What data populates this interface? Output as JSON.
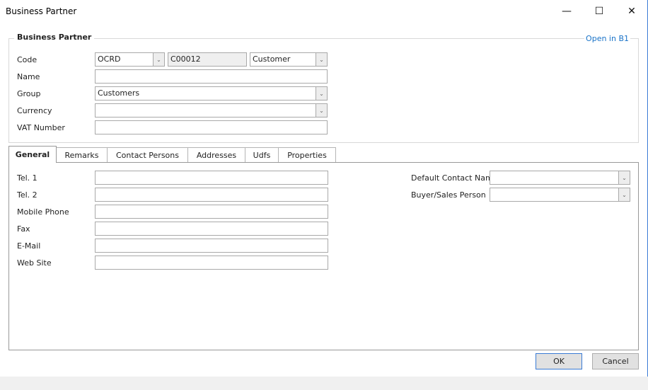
{
  "window": {
    "title": "Business Partner",
    "minimize": "—",
    "maximize": "☐",
    "close": "✕"
  },
  "header": {
    "legend": "Business Partner",
    "open_link": "Open in B1",
    "code_label": "Code",
    "code_series": "OCRD",
    "code_value": "C00012",
    "code_type": "Customer",
    "name_label": "Name",
    "name_value": "",
    "group_label": "Group",
    "group_value": "Customers",
    "currency_label": "Currency",
    "currency_value": "",
    "vat_label": "VAT Number",
    "vat_value": ""
  },
  "tabs": [
    {
      "label": "General"
    },
    {
      "label": "Remarks"
    },
    {
      "label": "Contact Persons"
    },
    {
      "label": "Addresses"
    },
    {
      "label": "Udfs"
    },
    {
      "label": "Properties"
    }
  ],
  "general": {
    "tel1": "Tel. 1",
    "tel2": "Tel. 2",
    "mobile": "Mobile Phone",
    "fax": "Fax",
    "email": "E-Mail",
    "web": "Web Site",
    "default_contact": "Default Contact Name",
    "buyer": "Buyer/Sales Person"
  },
  "buttons": {
    "ok": "OK",
    "cancel": "Cancel"
  },
  "icons": {
    "dropdown": "⌄"
  }
}
